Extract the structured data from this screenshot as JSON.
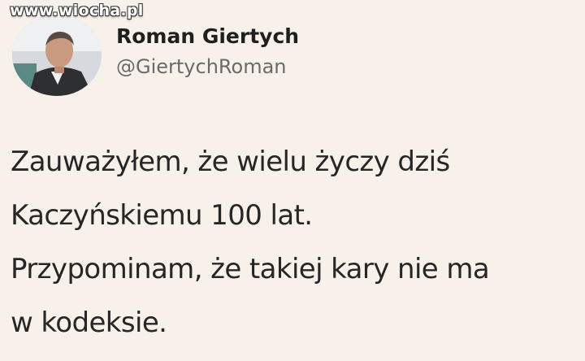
{
  "watermark": {
    "text": "www.wiocha.pl"
  },
  "author": {
    "display_name": "Roman Giertych",
    "handle": "@GiertychRoman"
  },
  "tweet": {
    "lines": [
      "Zauważyłem, że wielu życzy dziś",
      "Kaczyńskiemu 100 lat.",
      "Przypominam, że takiej kary nie ma",
      "w kodeksie."
    ]
  },
  "colors": {
    "background": "#f8f1e9",
    "text": "#262626",
    "handle": "#6a6a6a"
  }
}
